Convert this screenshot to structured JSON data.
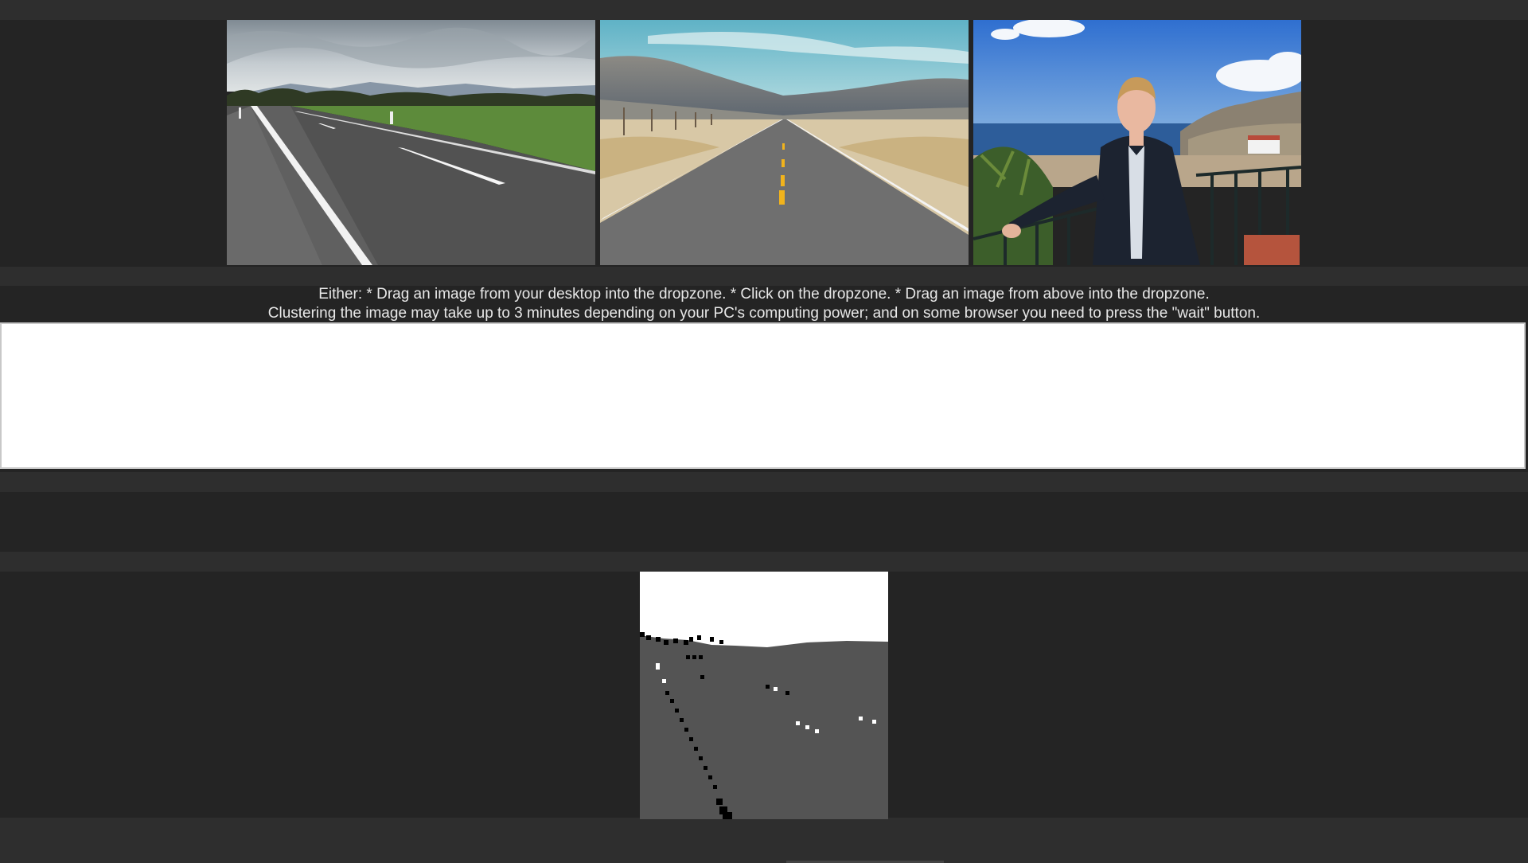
{
  "gallery": {
    "images": [
      {
        "name": "country-road-photo",
        "alt": "Road through green fields"
      },
      {
        "name": "desert-road-photo",
        "alt": "Straight desert highway"
      },
      {
        "name": "portrait-photo",
        "alt": "Man standing on a balcony by the sea"
      }
    ]
  },
  "instructions": {
    "line1": "Either: * Drag an image from your desktop into the dropzone. * Click on the dropzone. * Drag an image from above into the dropzone.",
    "line2": "Clustering the image may take up to 3 minutes depending on your PC's computing power; and on some browser you need to press the \"wait\" button."
  },
  "colors": {
    "page_bg": "#242424",
    "band_bg": "#2e2e2e",
    "dropzone_bg": "#ffffff",
    "cluster_light": "#ffffff",
    "cluster_mid": "#545454",
    "cluster_dark": "#000000"
  }
}
